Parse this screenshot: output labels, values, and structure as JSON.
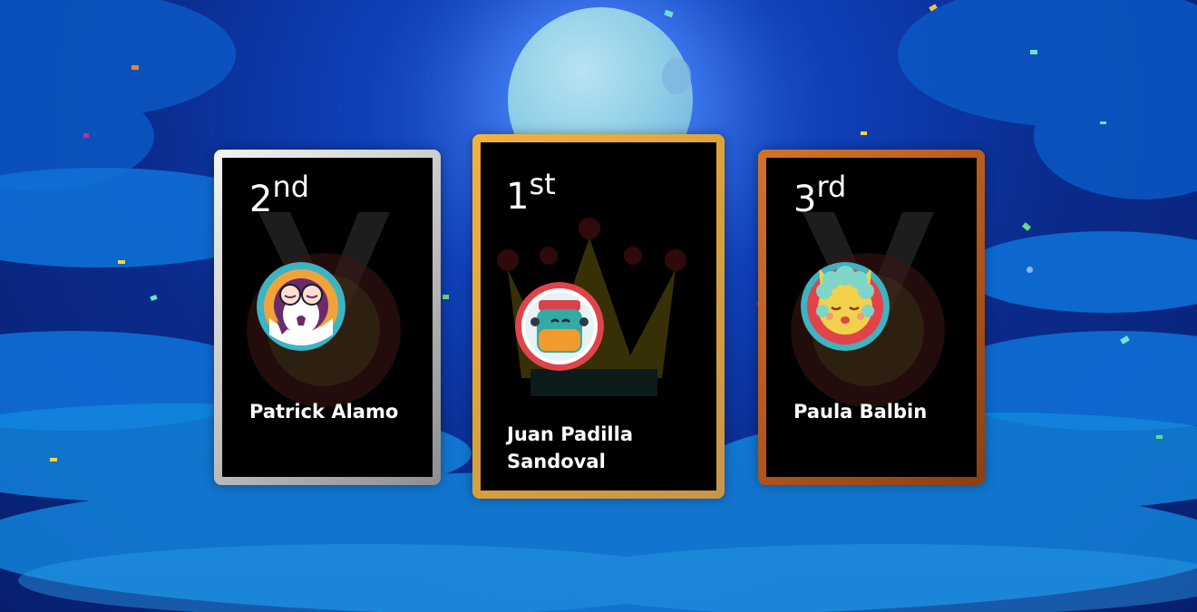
{
  "podium": {
    "first": {
      "rank_number": "1",
      "rank_suffix": "st",
      "name": "Juan Padilla Sandoval",
      "border_color": "#f3b13d"
    },
    "second": {
      "rank_number": "2",
      "rank_suffix": "nd",
      "name": "Patrick Alamo",
      "border_color": "#c9c9c9"
    },
    "third": {
      "rank_number": "3",
      "rank_suffix": "rd",
      "name": "Paula Balbin",
      "border_color": "#b0561c"
    }
  },
  "colors": {
    "sky": "#0a2b8c",
    "moon": "#8ecde6",
    "card_bg": "#000000"
  }
}
